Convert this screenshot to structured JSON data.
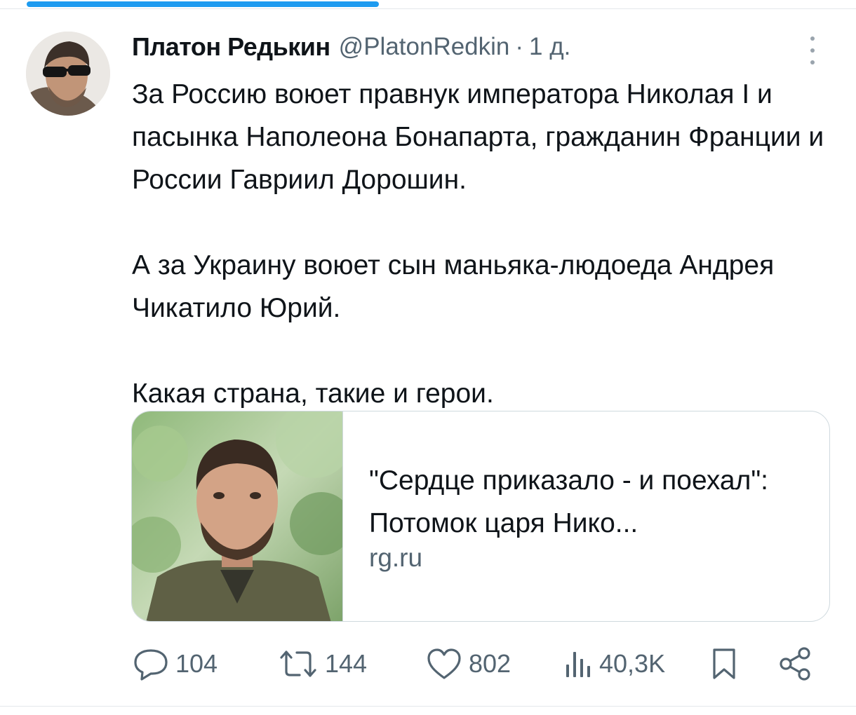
{
  "tweet": {
    "author": {
      "display_name": "Платон Редькин",
      "handle": "@PlatonRedkin",
      "separator": "·",
      "time": "1 д."
    },
    "paragraphs": [
      "За Россию воюет правнук императора Николая I и пасынка Наполеона Бонапарта, гражданин Франции и России Гавриил Дорошин.",
      "А за Украину воюет сын маньяка-людоеда Андрея Чикатило Юрий.",
      "Какая страна, такие и герои."
    ],
    "link_card": {
      "title": "\"Сердце приказало - и поехал\": Потомок царя Нико...",
      "domain": "rg.ru"
    },
    "stats": {
      "replies": "104",
      "retweets": "144",
      "likes": "802",
      "views": "40,3K"
    }
  },
  "colors": {
    "accent": "#1d9bf0",
    "text": "#0f1419",
    "secondary": "#536471",
    "border": "#cfd9de"
  },
  "icons": [
    "reply-icon",
    "retweet-icon",
    "like-icon",
    "views-icon",
    "bookmark-icon",
    "share-icon",
    "more-icon"
  ]
}
